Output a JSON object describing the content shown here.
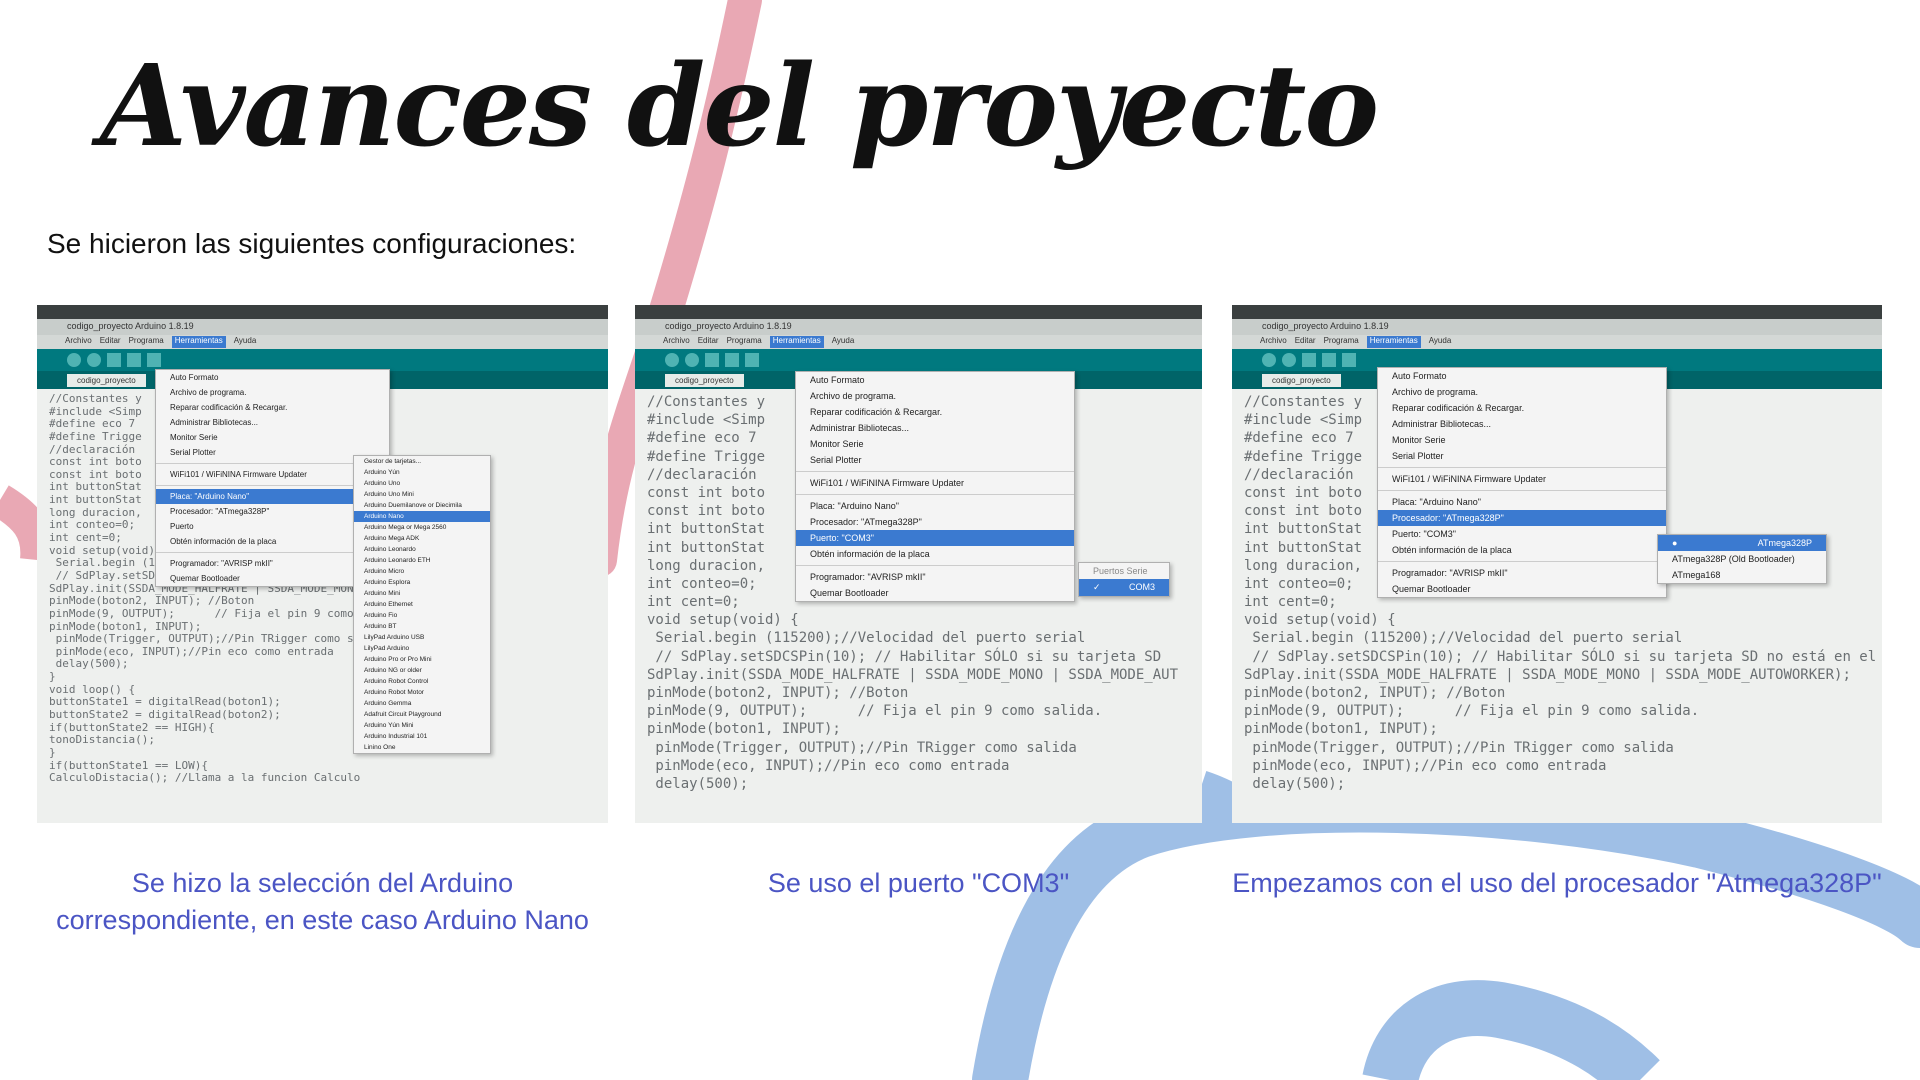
{
  "title": "Avances del proyecto",
  "subtitle": "Se hicieron las siguientes configuraciones:",
  "colors": {
    "caption": "#4b55c4",
    "pink": "#e9a8b4",
    "blue": "#9fbfe6",
    "title": "#111111"
  },
  "photos": [
    {
      "window_title": "codigo_proyecto Arduino 1.8.19",
      "menu": [
        "Archivo",
        "Editar",
        "Programa",
        "Herramientas",
        "Ayuda"
      ],
      "tab": "codigo_proyecto",
      "code": "//Constantes y\n#include <Simp\n#define eco 7\n#define Trigge\n//declaración\nconst int boto\nconst int boto\nint buttonStat\nint buttonStat\nlong duracion,\nint conteo=0;\nint cent=0;\nvoid setup(void) {\n Serial.begin (115200);//Velocidad del puerto se\n // SdPlay.setSDCSPin(10); // Habilitar SÓLO si\nSdPlay.init(SSDA_MODE_HALFRATE | SSDA_MODE_MONO\npinMode(boton2, INPUT); //Boton\npinMode(9, OUTPUT);      // Fija el pin 9 como s\npinMode(boton1, INPUT);\n pinMode(Trigger, OUTPUT);//Pin TRigger como sal\n pinMode(eco, INPUT);//Pin eco como entrada\n delay(500);\n}\nvoid loop() {\nbuttonState1 = digitalRead(boton1);\nbuttonState2 = digitalRead(boton2);\nif(buttonState2 == HIGH){\ntonoDistancia();\n}\nif(buttonState1 == LOW){\nCalculoDistacia(); //Llama a la funcion Calculo",
      "tools_menu": [
        "Auto Formato",
        "Archivo de programa.",
        "Reparar codificación & Recargar.",
        "Administrar Bibliotecas...",
        "Monitor Serie",
        "Serial Plotter",
        "WiFi101 / WiFiNINA Firmware Updater",
        "Placa: \"Arduino Nano\"",
        "Procesador: \"ATmega328P\"",
        "Puerto",
        "Obtén información de la placa",
        "Programador: \"AVRISP mkII\"",
        "Quemar Bootloader"
      ],
      "boards": [
        "Gestor de tarjetas...",
        "Arduino Yún",
        "Arduino Uno",
        "Arduino Uno Mini",
        "Arduino Duemilanove or Diecimila",
        "Arduino Nano",
        "Arduino Mega or Mega 2560",
        "Arduino Mega ADK",
        "Arduino Leonardo",
        "Arduino Leonardo ETH",
        "Arduino Micro",
        "Arduino Esplora",
        "Arduino Mini",
        "Arduino Ethernet",
        "Arduino Fio",
        "Arduino BT",
        "LilyPad Arduino USB",
        "LilyPad Arduino",
        "Arduino Pro or Pro Mini",
        "Arduino NG or older",
        "Arduino Robot Control",
        "Arduino Robot Motor",
        "Arduino Gemma",
        "Adafruit Circuit Playground",
        "Arduino Yún Mini",
        "Arduino Industrial 101",
        "Linino One"
      ]
    },
    {
      "window_title": "codigo_proyecto Arduino 1.8.19",
      "menu": [
        "Archivo",
        "Editar",
        "Programa",
        "Herramientas",
        "Ayuda"
      ],
      "tab": "codigo_proyecto",
      "code": "//Constantes y\n#include <Simp\n#define eco 7\n#define Trigge\n//declaración\nconst int boto\nconst int boto\nint buttonStat\nint buttonStat\nlong duracion,\nint conteo=0;\nint cent=0;\nvoid setup(void) {\n Serial.begin (115200);//Velocidad del puerto serial\n // SdPlay.setSDCSPin(10); // Habilitar SÓLO si su tarjeta SD\nSdPlay.init(SSDA_MODE_HALFRATE | SSDA_MODE_MONO | SSDA_MODE_AUT\npinMode(boton2, INPUT); //Boton\npinMode(9, OUTPUT);      // Fija el pin 9 como salida.\npinMode(boton1, INPUT);\n pinMode(Trigger, OUTPUT);//Pin TRigger como salida\n pinMode(eco, INPUT);//Pin eco como entrada\n delay(500);",
      "tools_menu": [
        "Auto Formato",
        "Archivo de programa.",
        "Reparar codificación & Recargar.",
        "Administrar Bibliotecas...",
        "Monitor Serie",
        "Serial Plotter",
        "WiFi101 / WiFiNINA Firmware Updater",
        "Placa: \"Arduino Nano\"",
        "Procesador: \"ATmega328P\"",
        "Puerto: \"COM3\"",
        "Obtén información de la placa",
        "Programador: \"AVRISP mkII\"",
        "Quemar Bootloader"
      ],
      "port_submenu": [
        "Puertos Serie",
        "COM3"
      ]
    },
    {
      "window_title": "codigo_proyecto Arduino 1.8.19",
      "menu": [
        "Archivo",
        "Editar",
        "Programa",
        "Herramientas",
        "Ayuda"
      ],
      "tab": "codigo_proyecto",
      "code": "//Constantes y\n#include <Simp\n#define eco 7\n#define Trigge\n//declaración\nconst int boto\nconst int boto\nint buttonStat\nint buttonStat\nlong duracion,\nint conteo=0;\nint cent=0;\nvoid setup(void) {\n Serial.begin (115200);//Velocidad del puerto serial\n // SdPlay.setSDCSPin(10); // Habilitar SÓLO si su tarjeta SD no está en el\nSdPlay.init(SSDA_MODE_HALFRATE | SSDA_MODE_MONO | SSDA_MODE_AUTOWORKER);\npinMode(boton2, INPUT); //Boton\npinMode(9, OUTPUT);      // Fija el pin 9 como salida.\npinMode(boton1, INPUT);\n pinMode(Trigger, OUTPUT);//Pin TRigger como salida\n pinMode(eco, INPUT);//Pin eco como entrada\n delay(500);",
      "tools_menu": [
        "Auto Formato",
        "Archivo de programa.",
        "Reparar codificación & Recargar.",
        "Administrar Bibliotecas...",
        "Monitor Serie",
        "Serial Plotter",
        "WiFi101 / WiFiNINA Firmware Updater",
        "Placa: \"Arduino Nano\"",
        "Procesador: \"ATmega328P\"",
        "Puerto: \"COM3\"",
        "Obtén información de la placa",
        "Programador: \"AVRISP mkII\"",
        "Quemar Bootloader"
      ],
      "processor_submenu": [
        "ATmega328P",
        "ATmega328P (Old Bootloader)",
        "ATmega168"
      ]
    }
  ],
  "captions": [
    "Se hizo la selección del Arduino correspondiente, en este caso Arduino Nano",
    "Se uso el puerto \"COM3\"",
    "Empezamos con el uso del procesador \"Atmega328P\""
  ]
}
